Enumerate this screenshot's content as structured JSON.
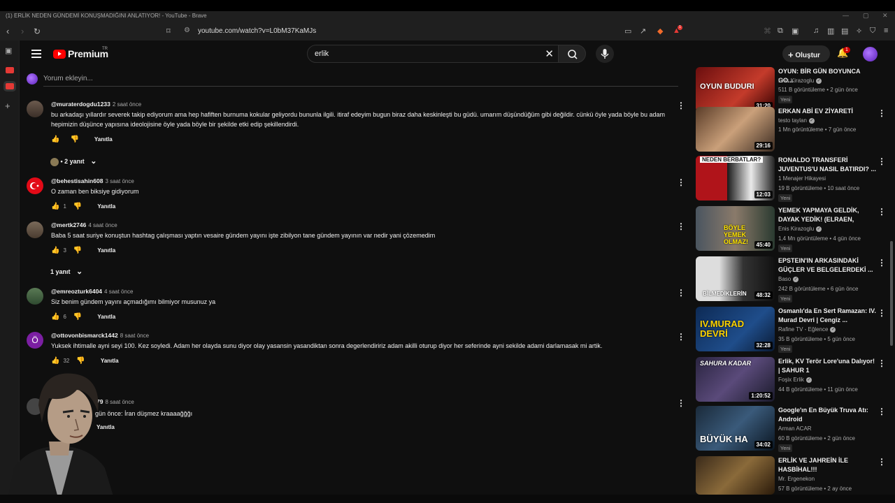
{
  "browser": {
    "window_title": "(1) ERLİK NEDEN GÜNDEMİ KONUŞMADIĞINI ANLATIYOR! - YouTube - Brave",
    "url": "youtube.com/watch?v=L0bM37KaMJs",
    "extension_badge": "1"
  },
  "header": {
    "logo_text": "Premium",
    "logo_sup": "TR",
    "search_value": "erlik",
    "create_label": "Oluştur",
    "notif_count": "1"
  },
  "add_comment": {
    "placeholder": "Yorum ekleyin..."
  },
  "comments": [
    {
      "user": "@muraterdogdu1233",
      "time": "2 saat önce",
      "text": "bu arkadaşı yıllardır severek takip ediyorum ama hep hafiften burnuma kokular geliyordu bununla ilgili. itiraf edeyim bugun biraz daha keskinleşti bu güdü. umarım düşündüğüm gibi değildir. cünkü öyle yada böyle bu adam hepimizin düşünce yapısına ideolojisine öyle yada böyle bir şekilde etki edip şekillendirdi.",
      "likes": "",
      "reply_label": "Yanıtla",
      "replies": "• 2 yanıt"
    },
    {
      "user": "@behestisahin608",
      "time": "3 saat önce",
      "text": "O zaman ben biksiye gidiyorum",
      "likes": "1",
      "reply_label": "Yanıtla"
    },
    {
      "user": "@mertk2746",
      "time": "4 saat önce",
      "text": "Baba 5 saat suriye konuştun hashtag çalışması yaptın vesaire gündem yayını işte zibilyon tane gündem yayının var nedir yani çözemedim",
      "likes": "3",
      "reply_label": "Yanıtla",
      "replies": "1 yanıt"
    },
    {
      "user": "@emreozturk6404",
      "time": "4 saat önce",
      "text": "Siz benim gündem yayını açmadığımı bilmiyor musunuz ya",
      "likes": "6",
      "reply_label": "Yanıtla"
    },
    {
      "user": "@ottovonbismarck1442",
      "time": "8 saat önce",
      "avatar_letter": "Ö",
      "text": "Yuksek ihtimalle ayni seyi 100. Kez soyledi. Adam her olayda sunu diyor olay yasansin yasandiktan sonra degerlendiririz adam akilli oturup diyor her seferinde ayni sekilde adami darlamasak mi artik.",
      "likes": "32",
      "reply_label": "Yanıtla"
    },
    {
      "user": "79",
      "time": "8 saat önce",
      "text": "gün önce: İran düşmez kraaaağğğı",
      "likes": "",
      "reply_label": "Yanıtla"
    }
  ],
  "recommendations": [
    {
      "title": "OYUN: BİR GÜN BOYUNCA GO...",
      "channel": "Enis Kirazoglu",
      "verified": true,
      "views": "511 B görüntüleme • 2 gün önce",
      "badge": "Yeni",
      "duration": "31:20",
      "thumb_text": "OYUN BUDURI"
    },
    {
      "title": "ERKAN ABİ EV ZİYARETİ",
      "channel": "testo taylan",
      "verified": true,
      "views": "1 Mn görüntüleme • 7 gün önce",
      "badge": "",
      "duration": "29:16",
      "thumb_text": ""
    },
    {
      "title": "RONALDO TRANSFERİ JUVENTUS'U NASIL BATIRDI? ...",
      "channel": "1 Menajer Hikayesi",
      "verified": false,
      "views": "19 B görüntüleme • 10 saat önce",
      "badge": "Yeni",
      "duration": "12:03",
      "thumb_text": "NEDEN BERBATLAR?"
    },
    {
      "title": "YEMEK YAPMAYA GELDİK, DAYAK YEDİK! (ELRAEN, ERAY,...",
      "channel": "Enis Kirazoglu",
      "verified": true,
      "views": "1,4 Mn görüntüleme • 4 gün önce",
      "badge": "Yeni",
      "duration": "45:40",
      "thumb_text": "BÖYLE YEMEK OLMAZ!"
    },
    {
      "title": "EPSTEIN'IN ARKASINDAKİ GÜÇLER VE BELGELERDEKİ ...",
      "channel": "Baso",
      "verified": true,
      "views": "242 B görüntüleme • 6 gün önce",
      "badge": "Yeni",
      "duration": "48:32",
      "thumb_text": "BİLMEDİKLERİN"
    },
    {
      "title": "Osmanlı'da En Sert Ramazan: IV. Murad Devri | Cengiz ...",
      "channel": "Rafine TV - Eğlence",
      "verified": true,
      "views": "35 B görüntüleme • 5 gün önce",
      "badge": "Yeni",
      "duration": "32:28",
      "thumb_text": "IV.MURAD DEVRİ"
    },
    {
      "title": "Erlik, KV Terör Lore'una Dalıyor! | SAHUR 1",
      "channel": "Foşix Erlik",
      "verified": true,
      "views": "44 B görüntüleme • 11 gün önce",
      "badge": "",
      "duration": "1:20:52",
      "thumb_text": "SAHURA KADAR"
    },
    {
      "title": "Google'ın En Büyük Truva Atı: Android",
      "channel": "Arman ACAR",
      "verified": false,
      "views": "60 B görüntüleme • 2 gün önce",
      "badge": "Yeni",
      "duration": "34:02",
      "thumb_text": "BÜYÜK HA"
    },
    {
      "title": "ERLİK VE JAHREİN İLE HASBİHAL!!!",
      "channel": "Mr. Ergenekon",
      "verified": false,
      "views": "57 B görüntüleme • 2 ay önce",
      "badge": "",
      "duration": "",
      "thumb_text": ""
    }
  ],
  "icons": {
    "back": "←",
    "forward": "→",
    "reload": "↻",
    "bookmark": "🔖",
    "kebab": "⋮",
    "like": "👍",
    "dislike": "👎",
    "chevron_down": "⌄",
    "search": "🔍",
    "mic": "🎙",
    "bell": "🔔",
    "plus": "+",
    "close": "✕"
  },
  "colors": {
    "accent": "#ff0000",
    "bg": "#0f0f0f",
    "badge": "#cc0000"
  }
}
